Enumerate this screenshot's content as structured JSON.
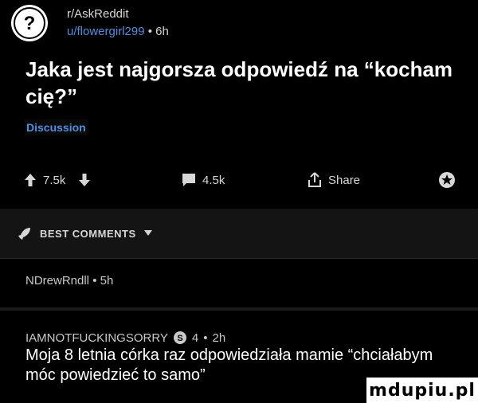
{
  "post": {
    "subreddit": "r/AskReddit",
    "username": "u/flowergirl299",
    "separator": "•",
    "age": "6h",
    "title": "Jaka jest najgorsza odpowiedź na “kocham cię?”",
    "flair": "Discussion",
    "avatar_icon": "question-mark-icon"
  },
  "actions": {
    "upvotes": "7.5k",
    "comments": "4.5k",
    "share": "Share"
  },
  "section": {
    "label": "BEST COMMENTS"
  },
  "comments": [
    {
      "author": "NDrewRndll",
      "separator": "•",
      "age": "5h"
    },
    {
      "author": "IAMNOTFUCKINGSORRY",
      "award_count": "4",
      "separator": "•",
      "age": "2h",
      "body": "Moja 8 letnia córka raz odpowiedziała mamie “chciałabym móc powiedzieć to samo”"
    }
  ],
  "watermark": "mdupiu.pl",
  "colors": {
    "background": "#000000",
    "accent": "#4a90e2",
    "section_bg": "#141414"
  }
}
